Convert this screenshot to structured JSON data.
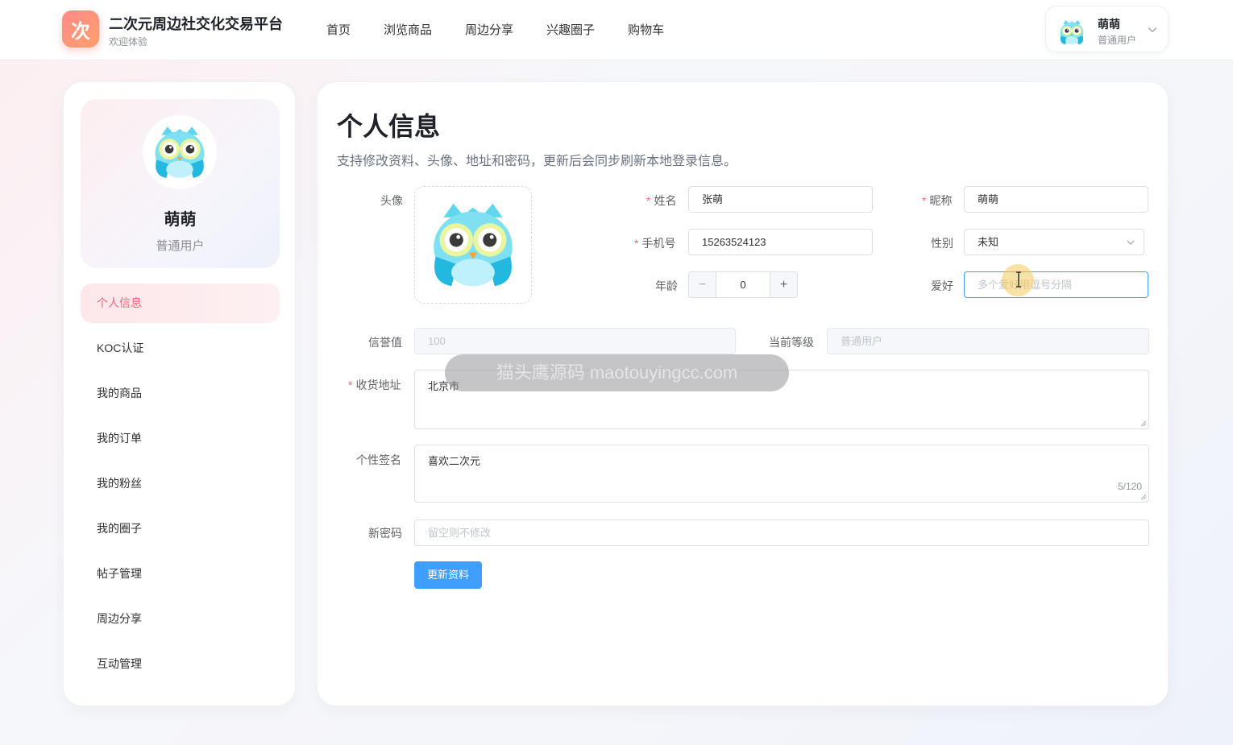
{
  "header": {
    "logo_char": "次",
    "brand_title": "二次元周边社交化交易平台",
    "brand_sub": "欢迎体验",
    "nav": [
      "首页",
      "浏览商品",
      "周边分享",
      "兴趣圈子",
      "购物车"
    ],
    "user": {
      "name": "萌萌",
      "role": "普通用户"
    }
  },
  "sidebar": {
    "profile": {
      "name": "萌萌",
      "role": "普通用户"
    },
    "menu": [
      "个人信息",
      "KOC认证",
      "我的商品",
      "我的订单",
      "我的粉丝",
      "我的圈子",
      "帖子管理",
      "周边分享",
      "互动管理"
    ],
    "active_index": 0
  },
  "main": {
    "title": "个人信息",
    "desc": "支持修改资料、头像、地址和密码，更新后会同步刷新本地登录信息。",
    "form": {
      "avatar_label": "头像",
      "name_label": "姓名",
      "name_value": "张萌",
      "nickname_label": "昵称",
      "nickname_value": "萌萌",
      "phone_label": "手机号",
      "phone_value": "15263524123",
      "gender_label": "性别",
      "gender_value": "未知",
      "age_label": "年龄",
      "age_value": "0",
      "hobby_label": "爱好",
      "hobby_placeholder": "多个爱好用逗号分隔",
      "credit_label": "信誉值",
      "credit_value": "100",
      "level_label": "当前等级",
      "level_value": "普通用户",
      "address_label": "收货地址",
      "address_value": "北京市",
      "signature_label": "个性签名",
      "signature_value": "喜欢二次元",
      "signature_count": "5/120",
      "password_label": "新密码",
      "password_placeholder": "留空则不修改",
      "submit_label": "更新资料"
    }
  },
  "watermark": "猫头鹰源码 maotouyingcc.com",
  "colors": {
    "primary": "#409eff",
    "accent": "#f0667a",
    "required": "#f56c6c"
  }
}
